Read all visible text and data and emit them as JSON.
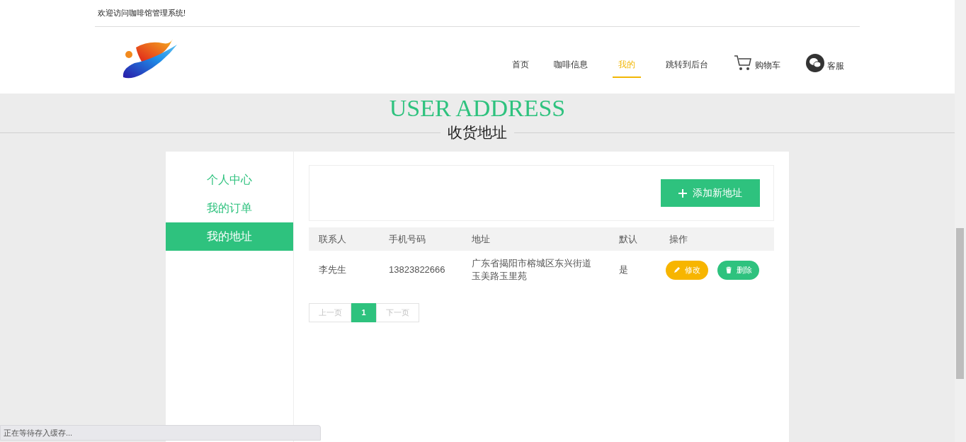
{
  "top_bar": {
    "welcome": "欢迎访问咖啡馆管理系统!"
  },
  "nav": {
    "items": [
      {
        "label": "首页",
        "selected": false
      },
      {
        "label": "咖啡信息",
        "selected": false
      },
      {
        "label": "我的",
        "selected": true
      },
      {
        "label": "跳转到后台",
        "selected": false
      }
    ],
    "cart": "购物车",
    "service": "客服"
  },
  "page_heading": {
    "title_en": "USER ADDRESS",
    "title": "收货地址"
  },
  "sidebar": {
    "items": [
      {
        "label": "个人中心",
        "selected": false
      },
      {
        "label": "我的订单",
        "selected": false
      },
      {
        "label": "我的地址",
        "selected": true
      }
    ]
  },
  "add_button": "添加新地址",
  "table": {
    "columns": [
      "联系人",
      "手机号码",
      "地址",
      "默认",
      "操作"
    ],
    "rows": [
      {
        "contact": "李先生",
        "phone": "13823822666",
        "address": "广东省揭阳市榕城区东兴街道玉美路玉里苑",
        "default": "是",
        "edit": "修改",
        "delete": "删除"
      }
    ]
  },
  "pagination": {
    "prev": "上一页",
    "pages": [
      {
        "label": "1",
        "selected": true
      }
    ],
    "next": "下一页"
  },
  "status_bar": "正在等待存入缓存..."
}
